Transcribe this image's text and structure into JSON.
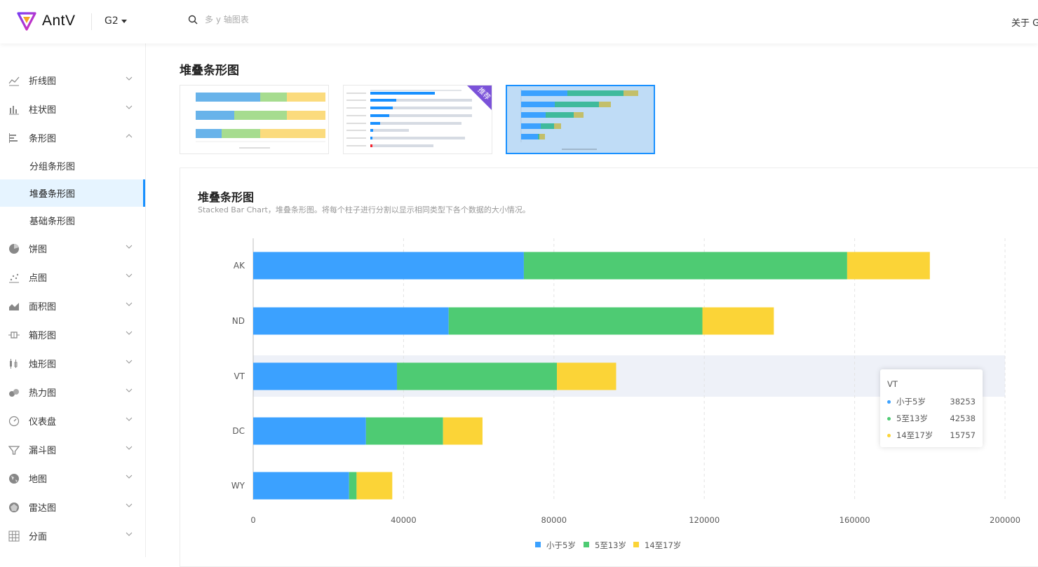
{
  "header": {
    "logo_text": "AntV",
    "product": "G2",
    "search_placeholder": "多 y 轴图表",
    "about": "关于 G"
  },
  "sidebar": {
    "items": [
      {
        "label": "折线图",
        "icon": "line-chart-icon",
        "expanded": false
      },
      {
        "label": "柱状图",
        "icon": "bar-chart-icon",
        "expanded": false
      },
      {
        "label": "条形图",
        "icon": "horizontal-bar-icon",
        "expanded": true,
        "children": [
          "分组条形图",
          "堆叠条形图",
          "基础条形图"
        ]
      },
      {
        "label": "饼图",
        "icon": "pie-chart-icon",
        "expanded": false
      },
      {
        "label": "点图",
        "icon": "dot-chart-icon",
        "expanded": false
      },
      {
        "label": "面积图",
        "icon": "area-chart-icon",
        "expanded": false
      },
      {
        "label": "箱形图",
        "icon": "box-plot-icon",
        "expanded": false
      },
      {
        "label": "烛形图",
        "icon": "candlestick-icon",
        "expanded": false
      },
      {
        "label": "热力图",
        "icon": "heatmap-icon",
        "expanded": false
      },
      {
        "label": "仪表盘",
        "icon": "gauge-icon",
        "expanded": false
      },
      {
        "label": "漏斗图",
        "icon": "funnel-icon",
        "expanded": false
      },
      {
        "label": "地图",
        "icon": "globe-icon",
        "expanded": false
      },
      {
        "label": "雷达图",
        "icon": "radar-icon",
        "expanded": false
      },
      {
        "label": "分面",
        "icon": "grid-icon",
        "expanded": false
      }
    ],
    "active_child": "堆叠条形图"
  },
  "main": {
    "section_title": "堆叠条形图",
    "thumb_badge": "推荐",
    "card_title": "堆叠条形图",
    "card_desc": "Stacked Bar Chart，堆叠条形图。将每个柱子进行分割以显示相同类型下各个数据的大小情况。"
  },
  "colors": {
    "series1": "#3ba1ff",
    "series2": "#4ecb73",
    "series3": "#fbd437",
    "accent": "#1890ff",
    "badge": "#7b52d9"
  },
  "chart_data": {
    "type": "bar",
    "orientation": "horizontal",
    "stacked": true,
    "categories": [
      "AK",
      "ND",
      "VT",
      "DC",
      "WY"
    ],
    "series": [
      {
        "name": "小于5岁",
        "values": [
          72000,
          52000,
          38253,
          30000,
          25500
        ]
      },
      {
        "name": "5至13岁",
        "values": [
          86000,
          67500,
          42538,
          20500,
          2000
        ]
      },
      {
        "name": "14至17岁",
        "values": [
          22000,
          19000,
          15757,
          10500,
          9500
        ]
      }
    ],
    "xlim": [
      0,
      200000
    ],
    "xticks": [
      "0",
      "40000",
      "80000",
      "120000",
      "160000",
      "200000"
    ],
    "grid": "vertical dashed",
    "legend": "bottom",
    "highlighted_category": "VT"
  },
  "tooltip": {
    "title": "VT",
    "rows": [
      {
        "name": "小于5岁",
        "value": "38253"
      },
      {
        "name": "5至13岁",
        "value": "42538"
      },
      {
        "name": "14至17岁",
        "value": "15757"
      }
    ]
  }
}
